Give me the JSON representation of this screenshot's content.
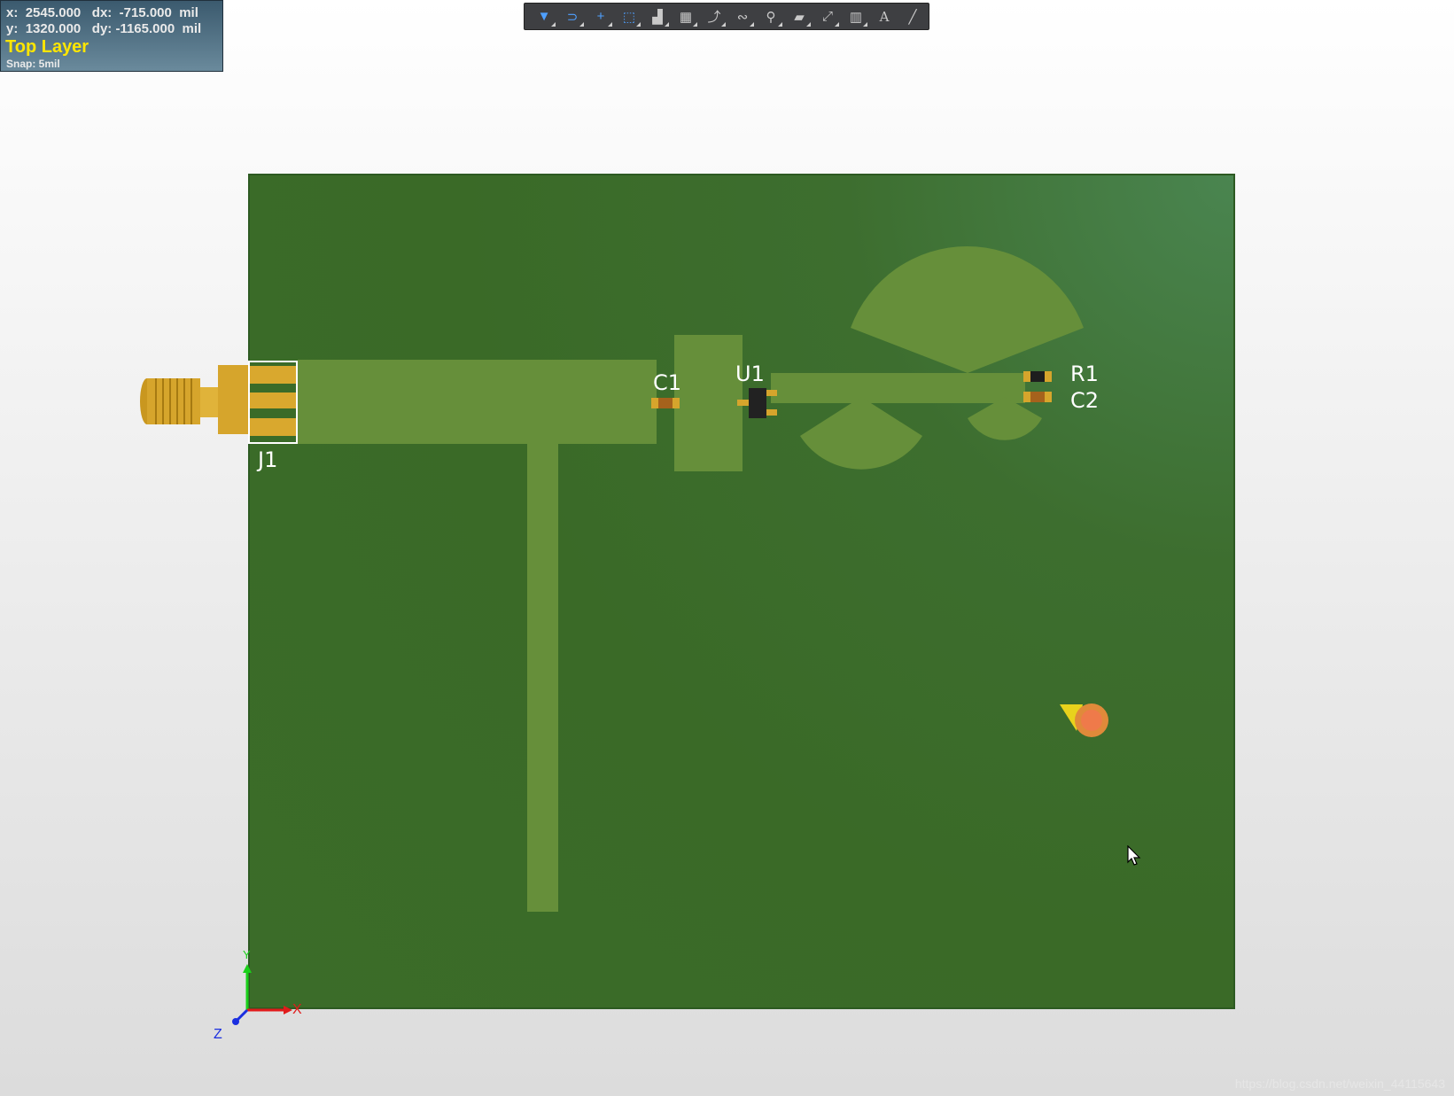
{
  "hud": {
    "x_label": "x:",
    "x_value": "2545.000",
    "dx_label": "dx:",
    "dx_value": "-715.000",
    "unit1": "mil",
    "y_label": "y:",
    "y_value": "1320.000",
    "dy_label": "dy:",
    "dy_value": "-1165.000",
    "unit2": "mil",
    "layer": "Top Layer",
    "snap": "Snap: 5mil"
  },
  "toolbar": {
    "buttons": [
      {
        "name": "filter-icon",
        "glyph": "▼"
      },
      {
        "name": "snap-magnet-icon",
        "glyph": "⊃"
      },
      {
        "name": "crosshair-icon",
        "glyph": "+"
      },
      {
        "name": "select-rect-icon",
        "glyph": "⬚"
      },
      {
        "name": "align-icon",
        "glyph": "▟"
      },
      {
        "name": "component-icon",
        "glyph": "▦"
      },
      {
        "name": "route-icon",
        "glyph": "⤴"
      },
      {
        "name": "diff-pair-icon",
        "glyph": "∾"
      },
      {
        "name": "via-icon",
        "glyph": "⚲"
      },
      {
        "name": "polygon-icon",
        "glyph": "▰"
      },
      {
        "name": "dimension-icon",
        "glyph": "⤢"
      },
      {
        "name": "graph-icon",
        "glyph": "▥"
      },
      {
        "name": "text-icon",
        "glyph": "A"
      },
      {
        "name": "line-icon",
        "glyph": "╱"
      }
    ]
  },
  "designators": {
    "j1": "J1",
    "c1": "C1",
    "u1": "U1",
    "r1": "R1",
    "c2": "C2"
  },
  "axes": {
    "x": "X",
    "y": "Y",
    "z": "Z"
  },
  "colors": {
    "board": "#3b6c29",
    "copper": "#668f3a",
    "connector_gold": "#d6a52c",
    "silkscreen": "#ffffff",
    "hud_layer": "#ffe600"
  },
  "watermark": "https://blog.csdn.net/weixin_44115643"
}
